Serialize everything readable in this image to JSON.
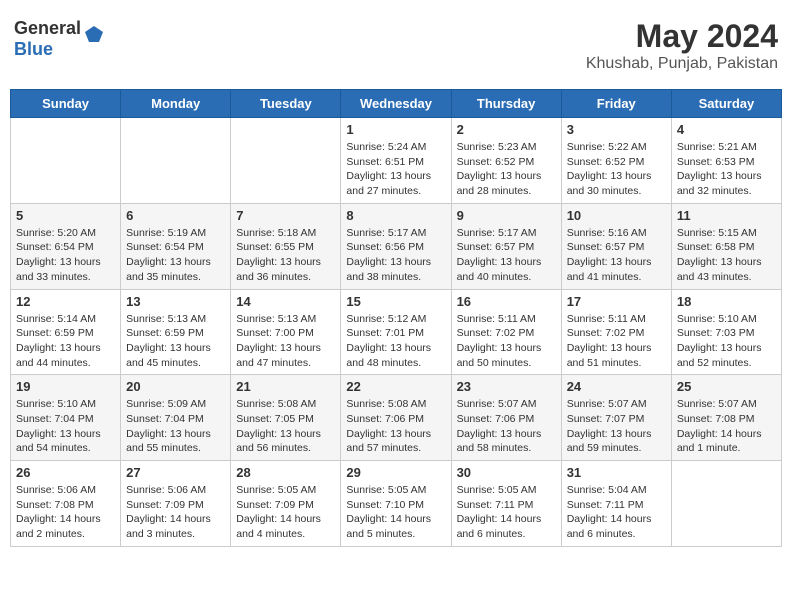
{
  "header": {
    "logo_general": "General",
    "logo_blue": "Blue",
    "month": "May 2024",
    "location": "Khushab, Punjab, Pakistan"
  },
  "weekdays": [
    "Sunday",
    "Monday",
    "Tuesday",
    "Wednesday",
    "Thursday",
    "Friday",
    "Saturday"
  ],
  "weeks": [
    [
      {
        "day": "",
        "info": ""
      },
      {
        "day": "",
        "info": ""
      },
      {
        "day": "",
        "info": ""
      },
      {
        "day": "1",
        "info": "Sunrise: 5:24 AM\nSunset: 6:51 PM\nDaylight: 13 hours and 27 minutes."
      },
      {
        "day": "2",
        "info": "Sunrise: 5:23 AM\nSunset: 6:52 PM\nDaylight: 13 hours and 28 minutes."
      },
      {
        "day": "3",
        "info": "Sunrise: 5:22 AM\nSunset: 6:52 PM\nDaylight: 13 hours and 30 minutes."
      },
      {
        "day": "4",
        "info": "Sunrise: 5:21 AM\nSunset: 6:53 PM\nDaylight: 13 hours and 32 minutes."
      }
    ],
    [
      {
        "day": "5",
        "info": "Sunrise: 5:20 AM\nSunset: 6:54 PM\nDaylight: 13 hours and 33 minutes."
      },
      {
        "day": "6",
        "info": "Sunrise: 5:19 AM\nSunset: 6:54 PM\nDaylight: 13 hours and 35 minutes."
      },
      {
        "day": "7",
        "info": "Sunrise: 5:18 AM\nSunset: 6:55 PM\nDaylight: 13 hours and 36 minutes."
      },
      {
        "day": "8",
        "info": "Sunrise: 5:17 AM\nSunset: 6:56 PM\nDaylight: 13 hours and 38 minutes."
      },
      {
        "day": "9",
        "info": "Sunrise: 5:17 AM\nSunset: 6:57 PM\nDaylight: 13 hours and 40 minutes."
      },
      {
        "day": "10",
        "info": "Sunrise: 5:16 AM\nSunset: 6:57 PM\nDaylight: 13 hours and 41 minutes."
      },
      {
        "day": "11",
        "info": "Sunrise: 5:15 AM\nSunset: 6:58 PM\nDaylight: 13 hours and 43 minutes."
      }
    ],
    [
      {
        "day": "12",
        "info": "Sunrise: 5:14 AM\nSunset: 6:59 PM\nDaylight: 13 hours and 44 minutes."
      },
      {
        "day": "13",
        "info": "Sunrise: 5:13 AM\nSunset: 6:59 PM\nDaylight: 13 hours and 45 minutes."
      },
      {
        "day": "14",
        "info": "Sunrise: 5:13 AM\nSunset: 7:00 PM\nDaylight: 13 hours and 47 minutes."
      },
      {
        "day": "15",
        "info": "Sunrise: 5:12 AM\nSunset: 7:01 PM\nDaylight: 13 hours and 48 minutes."
      },
      {
        "day": "16",
        "info": "Sunrise: 5:11 AM\nSunset: 7:02 PM\nDaylight: 13 hours and 50 minutes."
      },
      {
        "day": "17",
        "info": "Sunrise: 5:11 AM\nSunset: 7:02 PM\nDaylight: 13 hours and 51 minutes."
      },
      {
        "day": "18",
        "info": "Sunrise: 5:10 AM\nSunset: 7:03 PM\nDaylight: 13 hours and 52 minutes."
      }
    ],
    [
      {
        "day": "19",
        "info": "Sunrise: 5:10 AM\nSunset: 7:04 PM\nDaylight: 13 hours and 54 minutes."
      },
      {
        "day": "20",
        "info": "Sunrise: 5:09 AM\nSunset: 7:04 PM\nDaylight: 13 hours and 55 minutes."
      },
      {
        "day": "21",
        "info": "Sunrise: 5:08 AM\nSunset: 7:05 PM\nDaylight: 13 hours and 56 minutes."
      },
      {
        "day": "22",
        "info": "Sunrise: 5:08 AM\nSunset: 7:06 PM\nDaylight: 13 hours and 57 minutes."
      },
      {
        "day": "23",
        "info": "Sunrise: 5:07 AM\nSunset: 7:06 PM\nDaylight: 13 hours and 58 minutes."
      },
      {
        "day": "24",
        "info": "Sunrise: 5:07 AM\nSunset: 7:07 PM\nDaylight: 13 hours and 59 minutes."
      },
      {
        "day": "25",
        "info": "Sunrise: 5:07 AM\nSunset: 7:08 PM\nDaylight: 14 hours and 1 minute."
      }
    ],
    [
      {
        "day": "26",
        "info": "Sunrise: 5:06 AM\nSunset: 7:08 PM\nDaylight: 14 hours and 2 minutes."
      },
      {
        "day": "27",
        "info": "Sunrise: 5:06 AM\nSunset: 7:09 PM\nDaylight: 14 hours and 3 minutes."
      },
      {
        "day": "28",
        "info": "Sunrise: 5:05 AM\nSunset: 7:09 PM\nDaylight: 14 hours and 4 minutes."
      },
      {
        "day": "29",
        "info": "Sunrise: 5:05 AM\nSunset: 7:10 PM\nDaylight: 14 hours and 5 minutes."
      },
      {
        "day": "30",
        "info": "Sunrise: 5:05 AM\nSunset: 7:11 PM\nDaylight: 14 hours and 6 minutes."
      },
      {
        "day": "31",
        "info": "Sunrise: 5:04 AM\nSunset: 7:11 PM\nDaylight: 14 hours and 6 minutes."
      },
      {
        "day": "",
        "info": ""
      }
    ]
  ]
}
